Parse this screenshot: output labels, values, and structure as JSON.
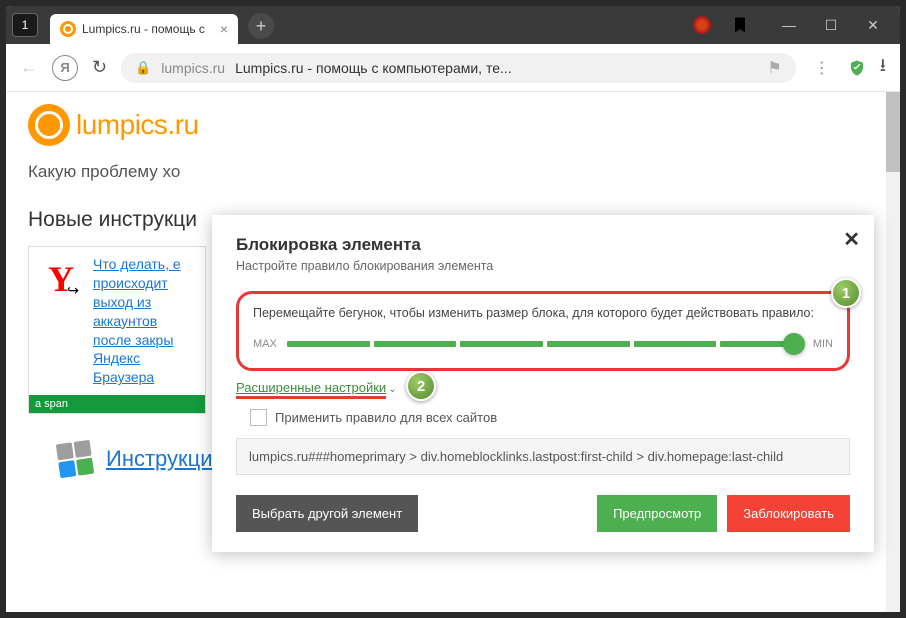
{
  "titlebar": {
    "tab_count": "1",
    "tab_title": "Lumpics.ru - помощь с"
  },
  "addressbar": {
    "yandex": "Я",
    "domain": "lumpics.ru",
    "title": "Lumpics.ru - помощь с компьютерами, те..."
  },
  "page": {
    "logo_text": "lumpics.ru",
    "search_placeholder": "Какую проблему хо",
    "section_title": "Новые инструкци",
    "card_link": "Что делать, е происходит выход из аккаунтов после закры Яндекс Браузера",
    "card_bar": "a span",
    "os_link": "Инструкции по операционным системам"
  },
  "modal": {
    "title": "Блокировка элемента",
    "subtitle": "Настройте правило блокирования элемента",
    "slider_label": "Перемещайте бегунок, чтобы изменить размер блока, для которого будет действовать правило:",
    "max": "MAX",
    "min": "MIN",
    "advanced": "Расширенные настройки",
    "apply_all": "Применить правило для всех сайтов",
    "rule": "lumpics.ru###homeprimary > div.homeblocklinks.lastpost:first-child > div.homepage:last-child",
    "btn_other": "Выбрать другой элемент",
    "btn_preview": "Предпросмотр",
    "btn_block": "Заблокировать",
    "callout1": "1",
    "callout2": "2"
  }
}
